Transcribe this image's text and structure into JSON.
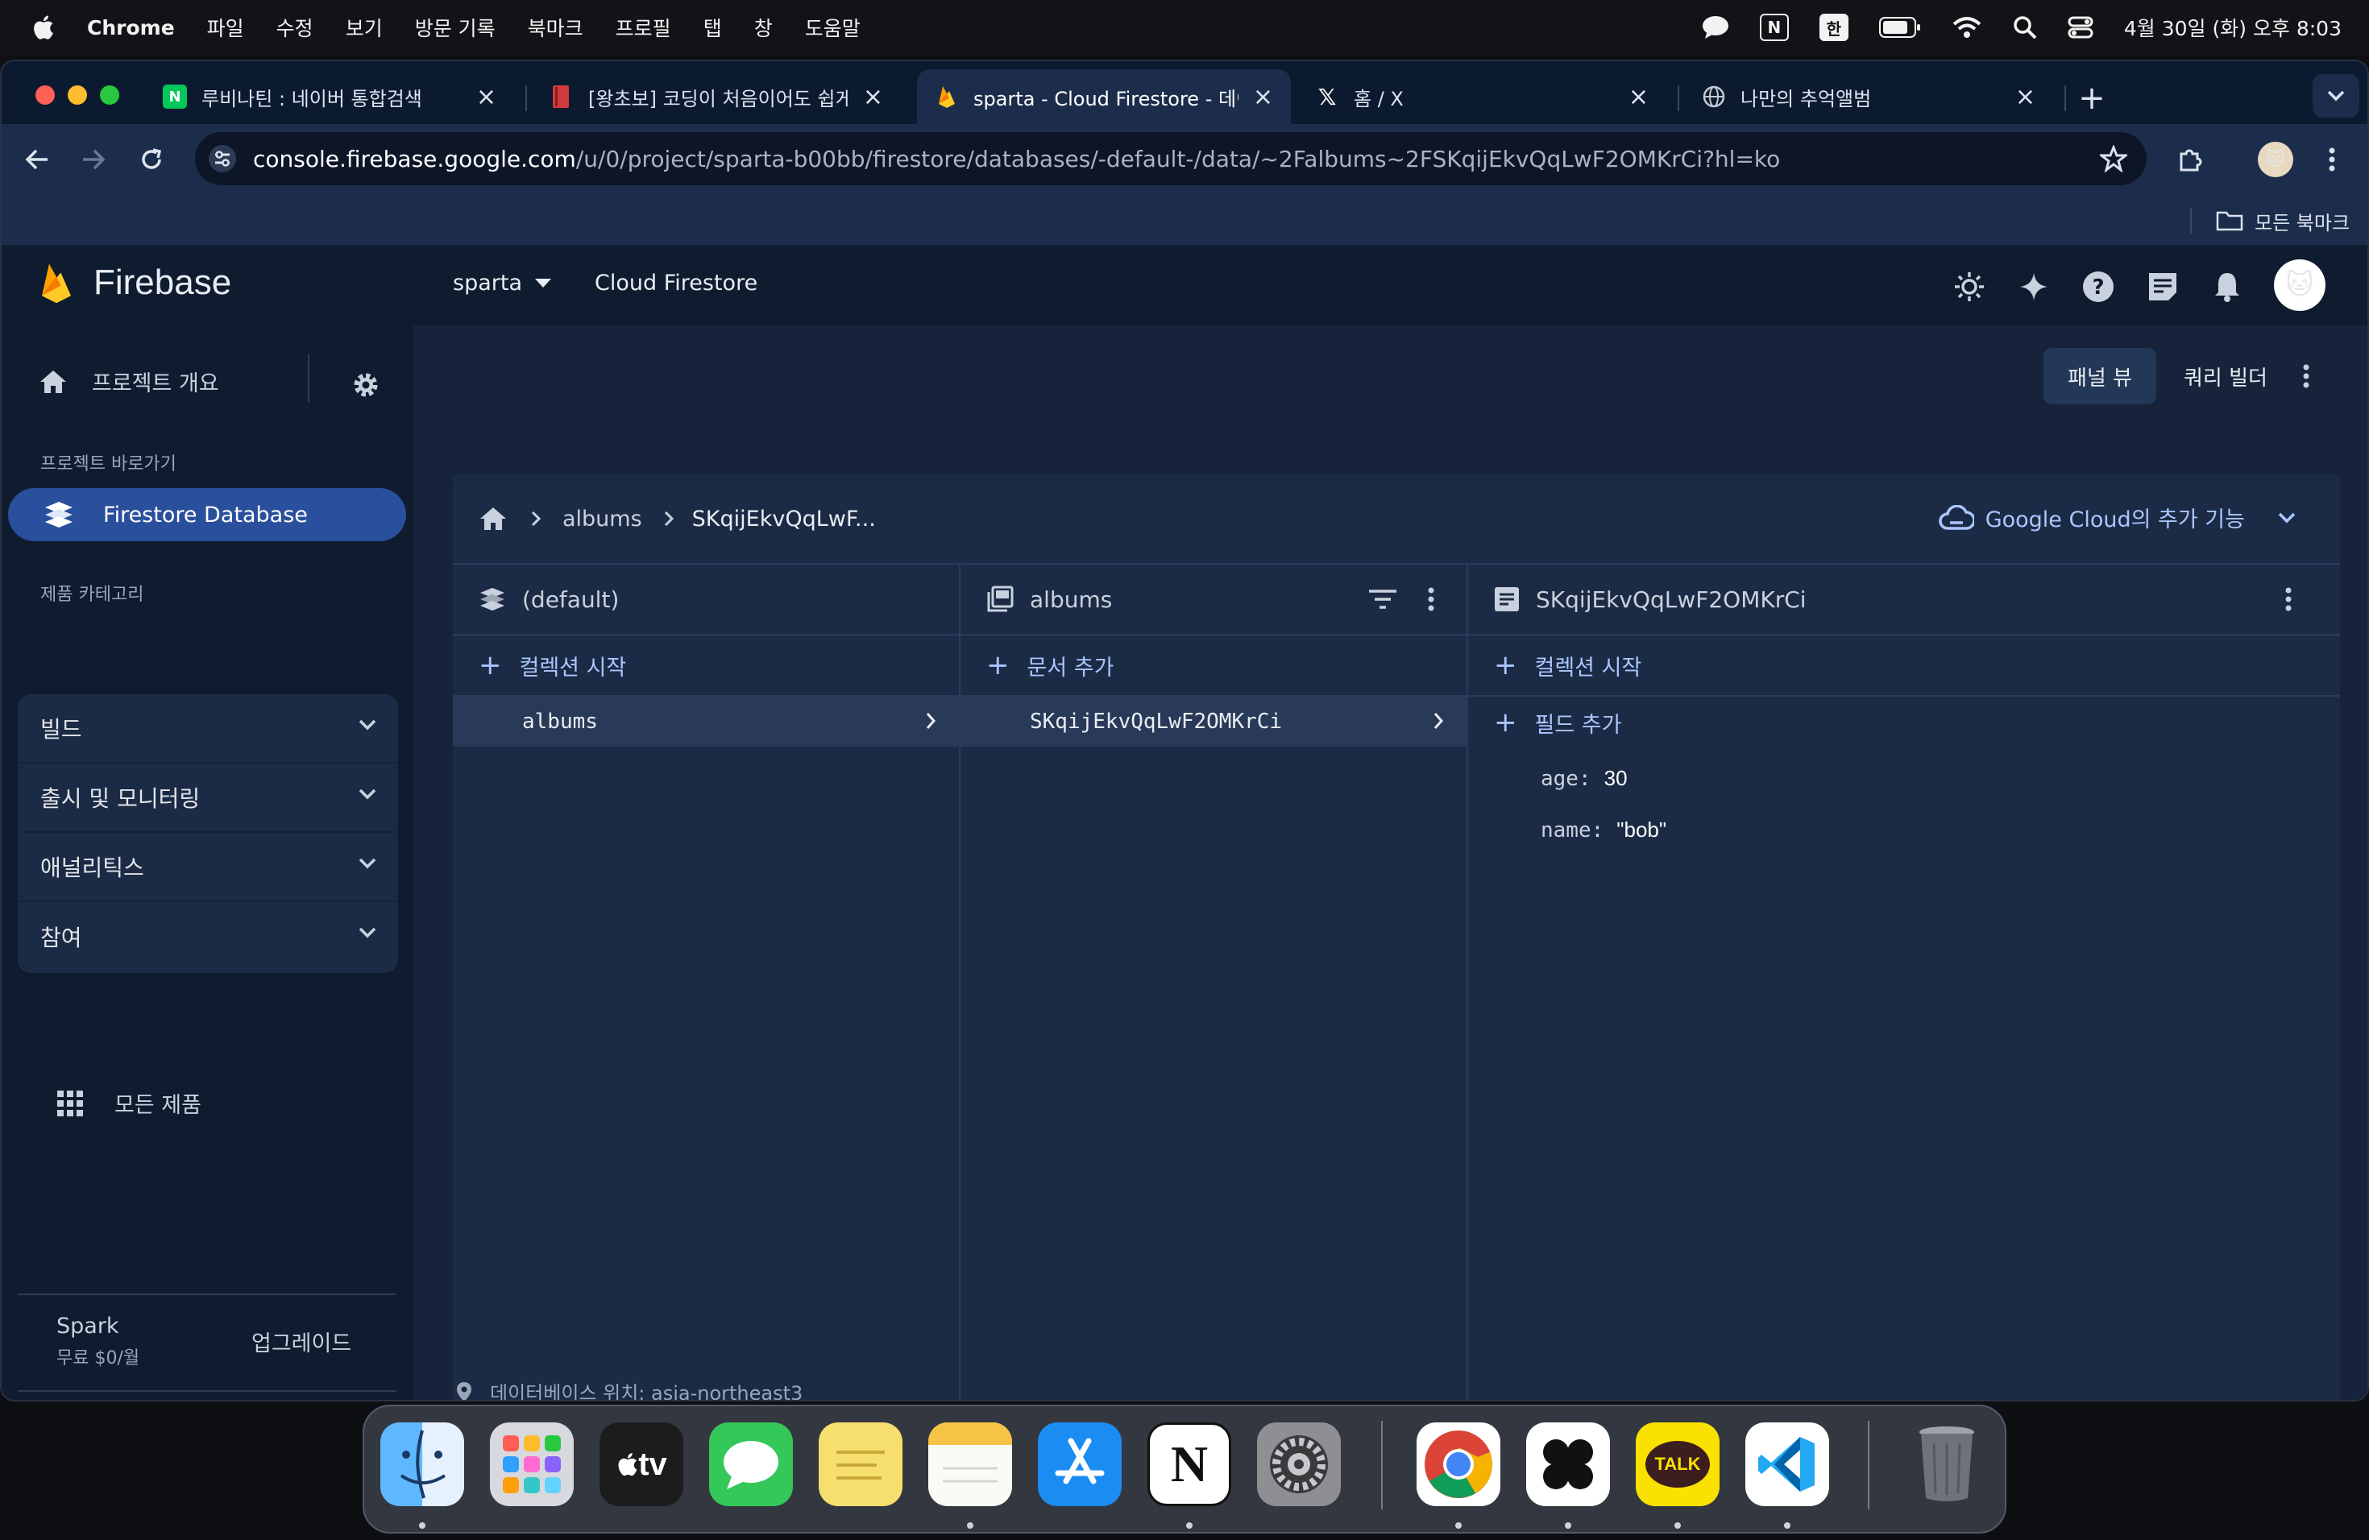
{
  "menubar": {
    "app_name": "Chrome",
    "items": [
      "파일",
      "수정",
      "보기",
      "방문 기록",
      "북마크",
      "프로필",
      "탭",
      "창",
      "도움말"
    ],
    "input_method": "한",
    "notion_indicator": "N",
    "clock": "4월 30일 (화) 오후 8:03"
  },
  "browser": {
    "tabs": [
      {
        "title": "루비나틴 : 네이버 통합검색",
        "favicon": "N",
        "favicon_color": "#03c75a",
        "active": false
      },
      {
        "title": "[왕초보] 코딩이 처음이어도 쉽게 배",
        "favicon": "book-icon",
        "favicon_color": "#d23b3b",
        "active": false
      },
      {
        "title": "sparta - Cloud Firestore - 데이",
        "favicon": "firebase-icon",
        "favicon_color": "#ffb300",
        "active": true
      },
      {
        "title": "홈 / X",
        "favicon": "x-icon",
        "favicon_color": "#ffffff",
        "active": false
      },
      {
        "title": "나만의 추억앨범",
        "favicon": "globe-icon",
        "favicon_color": "#c4c9d2",
        "active": false
      }
    ],
    "url_host": "console.firebase.google.com",
    "url_path": "/u/0/project/sparta-b00bb/firestore/databases/-default-/data/~2Falbums~2FSKqijEkvQqLwF2OMKrCi?hl=ko",
    "bookmarks_label": "모든 북마크"
  },
  "firebase": {
    "brand": "Firebase",
    "project": "sparta",
    "product": "Cloud Firestore",
    "sidebar": {
      "overview": "프로젝트 개요",
      "shortcuts_label": "프로젝트 바로가기",
      "active_item": "Firestore Database",
      "categories_label": "제품 카테고리",
      "categories": [
        "빌드",
        "출시 및 모니터링",
        "애널리틱스",
        "참여"
      ],
      "all_products": "모든 제품",
      "plan_name": "Spark",
      "plan_price": "무료 $0/월",
      "upgrade": "업그레이드"
    },
    "view_toggle": {
      "panel": "패널 뷰",
      "query": "쿼리 빌더"
    },
    "breadcrumb": [
      "albums",
      "SKqijEkvQqLwF..."
    ],
    "cloud_features": "Google Cloud의 추가 기능",
    "columns": {
      "root": {
        "title": "(default)",
        "add": "컬렉션 시작",
        "item": "albums"
      },
      "collection": {
        "title": "albums",
        "add": "문서 추가",
        "item": "SKqijEkvQqLwF2OMKrCi"
      },
      "document": {
        "title": "SKqijEkvQqLwF2OMKrCi",
        "add_collection": "컬렉션 시작",
        "add_field": "필드 추가",
        "fields": [
          {
            "key": "age:",
            "value": "30"
          },
          {
            "key": "name:",
            "value": "\"bob\""
          }
        ]
      }
    },
    "db_location": "데이터베이스 위치: asia-northeast3"
  },
  "dock": {
    "apps": [
      "finder",
      "launchpad",
      "apple-tv",
      "messages",
      "stickies",
      "notes",
      "app-store",
      "notion",
      "system-settings",
      "chrome",
      "figma",
      "kakaotalk",
      "vscode",
      "trash"
    ],
    "tv_label": "tv",
    "notion_letter": "N",
    "kakao_label": "TALK"
  }
}
